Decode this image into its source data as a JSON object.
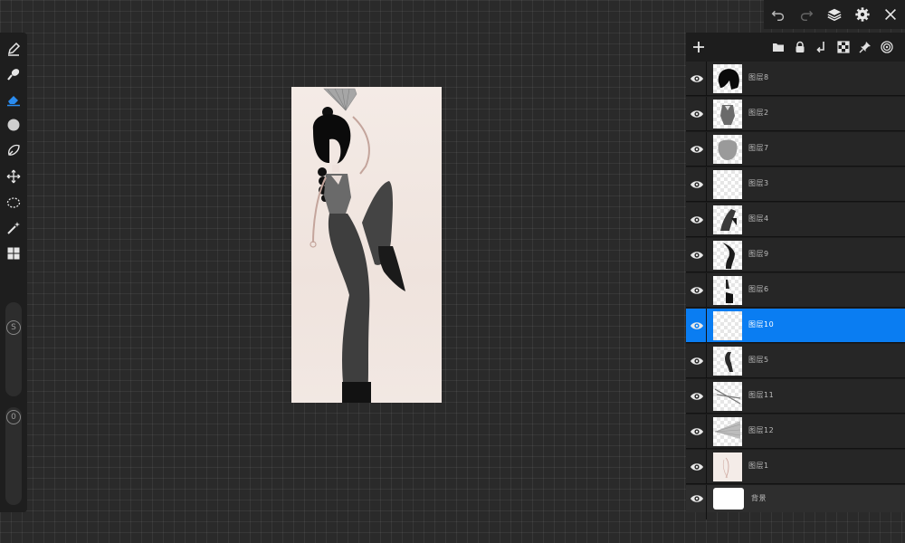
{
  "topbar": {
    "icons": [
      "undo-icon",
      "redo-icon",
      "layers-icon",
      "settings-icon",
      "close-icon"
    ]
  },
  "tools": {
    "items": [
      "pen-icon",
      "brush-icon",
      "eraser-icon",
      "circle-icon",
      "lasso-icon",
      "move-icon",
      "selection-icon",
      "magic-wand-icon",
      "grid-icon"
    ],
    "active": "eraser-icon",
    "size_label": "S",
    "opacity_label": "0"
  },
  "layers_panel": {
    "header_icons": [
      "add-layer-icon",
      "folder-icon",
      "lock-icon",
      "merge-down-icon",
      "transparency-icon",
      "pin-icon",
      "target-icon"
    ],
    "layers": [
      {
        "name": "图层8",
        "thumb": "hair"
      },
      {
        "name": "图层2",
        "thumb": "torso"
      },
      {
        "name": "图层7",
        "thumb": "blob"
      },
      {
        "name": "图层3",
        "thumb": "empty"
      },
      {
        "name": "图层4",
        "thumb": "leg"
      },
      {
        "name": "图层9",
        "thumb": "pant"
      },
      {
        "name": "图层6",
        "thumb": "foot"
      },
      {
        "name": "图层10",
        "thumb": "empty",
        "selected": true
      },
      {
        "name": "图层5",
        "thumb": "hand"
      },
      {
        "name": "图层11",
        "thumb": "lines"
      },
      {
        "name": "图层12",
        "thumb": "fan"
      },
      {
        "name": "图层1",
        "thumb": "sketch"
      },
      {
        "name": "背景",
        "thumb": "white",
        "background": true
      }
    ]
  }
}
